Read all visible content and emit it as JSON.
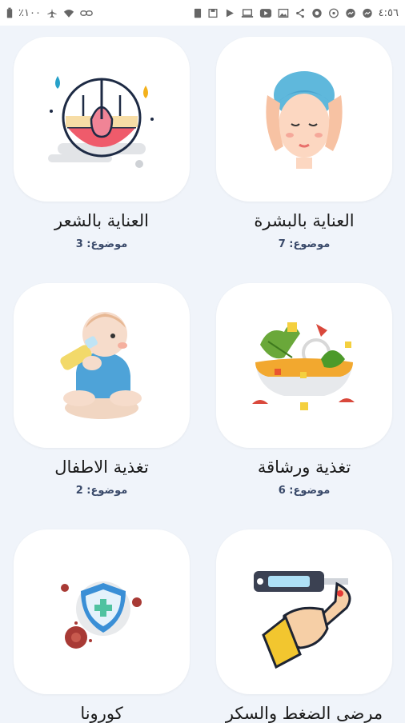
{
  "status_bar": {
    "time": "٤:٥٦",
    "battery": "٪١٠٠"
  },
  "categories": [
    {
      "title": "العناية بالبشرة",
      "count": "موضوع: 7",
      "icon": "face-massage-icon"
    },
    {
      "title": "العناية بالشعر",
      "count": "موضوع: 3",
      "icon": "hair-follicle-icon"
    },
    {
      "title": "تغذية ورشاقة",
      "count": "موضوع: 6",
      "icon": "salad-bowl-icon"
    },
    {
      "title": "تغذية الاطفال",
      "count": "موضوع: 2",
      "icon": "baby-bottle-icon"
    },
    {
      "title": "مرضى الضغط والسكر",
      "count": "",
      "icon": "glucose-meter-icon"
    },
    {
      "title": "كورونا",
      "count": "",
      "icon": "virus-shield-icon"
    }
  ]
}
